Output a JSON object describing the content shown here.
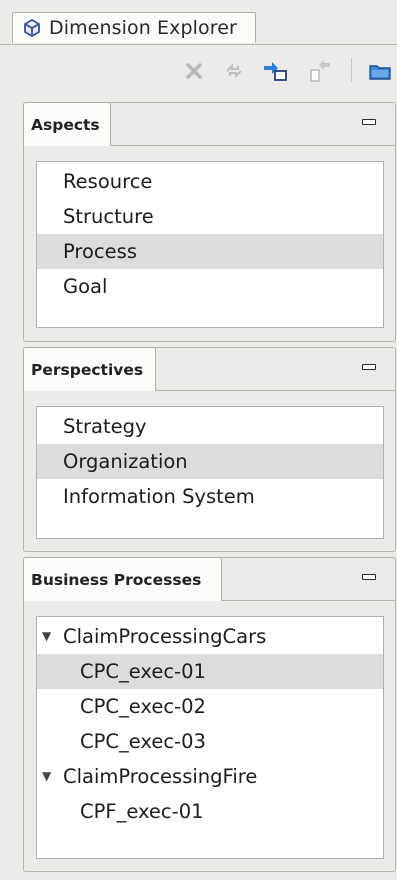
{
  "view": {
    "title": "Dimension Explorer",
    "icon": "cube-icon"
  },
  "toolbar": {
    "buttons": [
      {
        "name": "delete",
        "icon": "delete-x-icon",
        "enabled": false
      },
      {
        "name": "refresh",
        "icon": "refresh-icon",
        "enabled": false
      },
      {
        "name": "import",
        "icon": "import-arrow-icon",
        "enabled": true
      },
      {
        "name": "export",
        "icon": "export-arrow-icon",
        "enabled": false
      },
      {
        "name": "open-folder",
        "icon": "folder-icon",
        "enabled": true
      }
    ]
  },
  "aspects": {
    "tab_label": "Aspects",
    "items": [
      {
        "label": "Resource",
        "selected": false
      },
      {
        "label": "Structure",
        "selected": false
      },
      {
        "label": "Process",
        "selected": true
      },
      {
        "label": "Goal",
        "selected": false
      }
    ]
  },
  "perspectives": {
    "tab_label": "Perspectives",
    "items": [
      {
        "label": "Strategy",
        "selected": false
      },
      {
        "label": "Organization",
        "selected": true
      },
      {
        "label": "Information System",
        "selected": false
      }
    ]
  },
  "business_processes": {
    "tab_label": "Business Processes",
    "tree": [
      {
        "label": "ClaimProcessingCars",
        "expanded": true,
        "children": [
          {
            "label": "CPC_exec-01",
            "selected": true
          },
          {
            "label": "CPC_exec-02",
            "selected": false
          },
          {
            "label": "CPC_exec-03",
            "selected": false
          }
        ]
      },
      {
        "label": "ClaimProcessingFire",
        "expanded": true,
        "children": [
          {
            "label": "CPF_exec-01",
            "selected": false
          }
        ]
      }
    ]
  },
  "colors": {
    "background": "#ebeae8",
    "selection": "#dcdcdc",
    "icon_blue": "#2a7fd4"
  }
}
